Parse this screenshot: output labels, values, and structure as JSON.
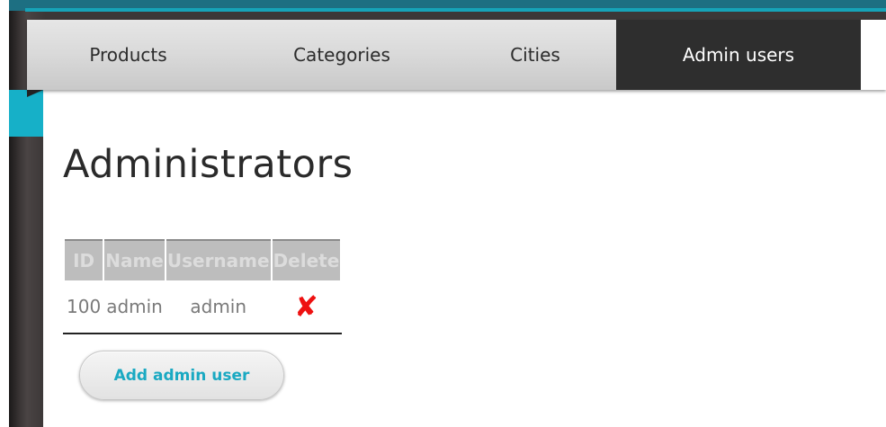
{
  "nav": {
    "tabs": [
      {
        "label": "Products",
        "active": false
      },
      {
        "label": "Categories",
        "active": false
      },
      {
        "label": "Cities",
        "active": false
      },
      {
        "label": "Admin users",
        "active": true
      }
    ]
  },
  "main": {
    "title": "Administrators",
    "table": {
      "headers": [
        "ID",
        "Name",
        "Username",
        "Delete"
      ],
      "rows": [
        {
          "id": "100",
          "name": "admin",
          "username": "admin",
          "delete_icon": "red-x-icon"
        }
      ]
    },
    "add_button_label": "Add admin user"
  },
  "colors": {
    "accent": "#1aa9c2",
    "active_tab_bg": "#2e2e2e",
    "delete_red": "#ee1111",
    "table_header_bg": "#bdbdbd"
  }
}
